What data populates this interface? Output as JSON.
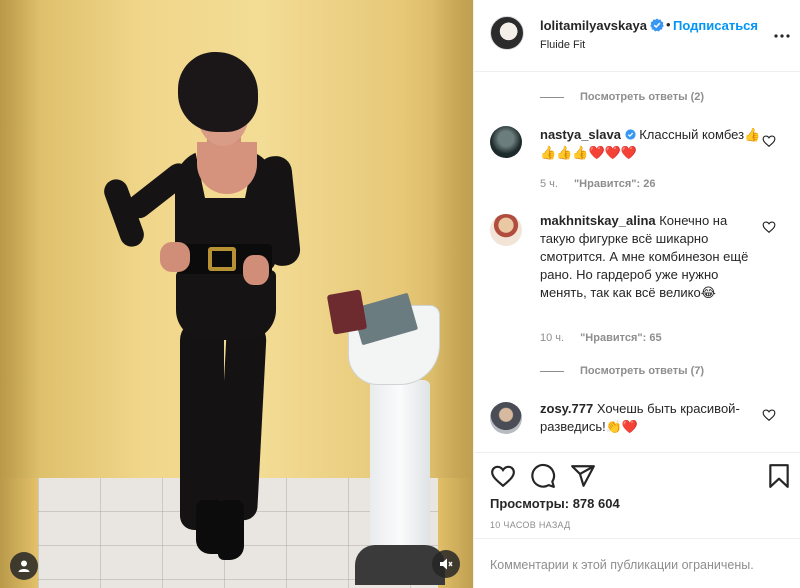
{
  "post": {
    "username": "lolitamilyavskaya",
    "separator": "•",
    "follow_label": "Подписаться",
    "location": "Fluide Fit",
    "more_icon": "more-horizontal-icon"
  },
  "comments": [
    {
      "type": "view_replies",
      "label": "Посмотреть ответы (2)"
    },
    {
      "username": "nastya_slava",
      "verified": true,
      "text": " Классный комбез👍👍👍👍❤️❤️❤️",
      "age": "5 ч.",
      "likes": "\"Нравится\": 26"
    },
    {
      "username": "makhnitskay_alina",
      "verified": false,
      "text": " Конечно на такую фигурке всё шикарно смотрится. А мне комбинезон ещё рано. Но гардероб уже нужно менять, так как всё велико😂",
      "age": "10 ч.",
      "likes": "\"Нравится\": 65"
    },
    {
      "type": "view_replies",
      "label": "Посмотреть ответы (7)"
    },
    {
      "username": "zosy.777",
      "verified": false,
      "text": " Хочешь быть красивой- разведись!👏❤️"
    }
  ],
  "stats": {
    "views_label": "Просмотры: 878 604",
    "time_label": "10 ЧАСОВ НАЗАД"
  },
  "footer": {
    "limited_text": "Комментарии к этой публикации ограничены."
  },
  "colors": {
    "accent": "#0095f6",
    "muted": "#8e8e8e",
    "text": "#262626",
    "heart_red": "#ed4956"
  }
}
